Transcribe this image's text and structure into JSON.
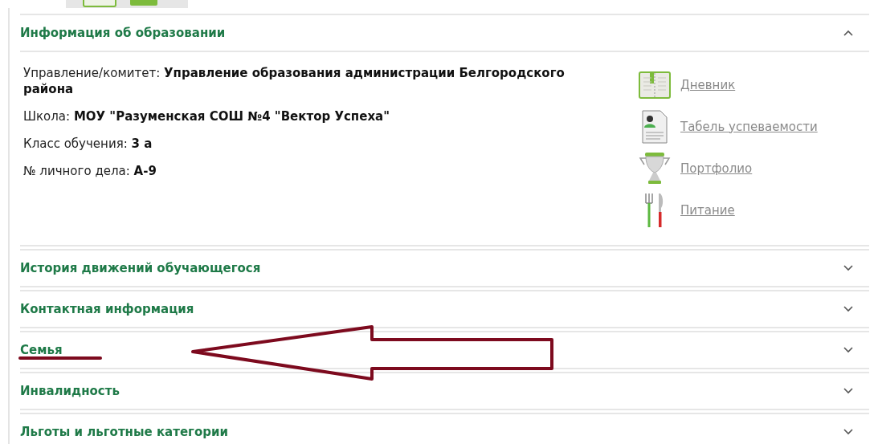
{
  "sections": [
    {
      "title": "Информация об образовании",
      "expanded": true,
      "fields": [
        {
          "label": "Управление/комитет:",
          "value": "Управление образования администрации Белгородского района"
        },
        {
          "label": "Школа:",
          "value": "МОУ \"Разуменская СОШ №4 \"Вектор Успеха\""
        },
        {
          "label": "Класс обучения:",
          "value": "3 а"
        },
        {
          "label": "№ личного дела:",
          "value": "А-9"
        }
      ],
      "links": [
        {
          "label": "Дневник",
          "kind": "diary"
        },
        {
          "label": "Табель успеваемости",
          "kind": "report"
        },
        {
          "label": "Портфолио",
          "kind": "trophy"
        },
        {
          "label": "Питание",
          "kind": "food"
        }
      ]
    },
    {
      "title": "История движений обучающегося",
      "expanded": false
    },
    {
      "title": "Контактная информация",
      "expanded": false
    },
    {
      "title": "Семья",
      "expanded": false
    },
    {
      "title": "Инвалидность",
      "expanded": false
    },
    {
      "title": "Льготы и льготные категории",
      "expanded": false
    }
  ]
}
